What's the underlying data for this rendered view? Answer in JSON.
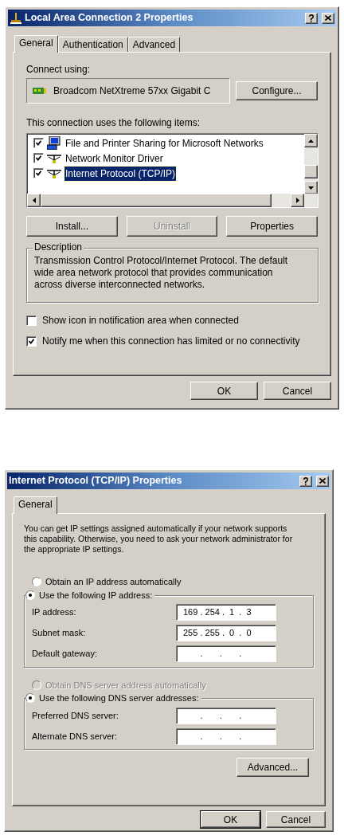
{
  "connection_dialog": {
    "title": "Local Area Connection 2 Properties",
    "tabs": [
      {
        "label": "General",
        "selected": true
      },
      {
        "label": "Authentication",
        "selected": false
      },
      {
        "label": "Advanced",
        "selected": false
      }
    ],
    "connect_using_label": "Connect using:",
    "adapter": "Broadcom NetXtreme 57xx Gigabit C",
    "configure_button": "Configure...",
    "items_label": "This connection uses the following items:",
    "items": [
      {
        "label": "File and Printer Sharing for Microsoft Networks",
        "kind": "service",
        "checked": true,
        "selected": false
      },
      {
        "label": "Network Monitor Driver",
        "kind": "protocol",
        "checked": true,
        "selected": false
      },
      {
        "label": "Internet Protocol (TCP/IP)",
        "kind": "protocol",
        "checked": true,
        "selected": true
      }
    ],
    "item_buttons": [
      {
        "label": "Install...",
        "disabled": false
      },
      {
        "label": "Uninstall",
        "disabled": true
      },
      {
        "label": "Properties",
        "disabled": false
      }
    ],
    "description": {
      "legend": "Description",
      "text": "Transmission Control Protocol/Internet Protocol. The default wide area network protocol that provides communication across diverse interconnected networks."
    },
    "options": [
      {
        "label": "Show icon in notification area when connected",
        "checked": false
      },
      {
        "label": "Notify me when this connection has limited or no connectivity",
        "checked": true
      }
    ],
    "footer_buttons": [
      {
        "label": "OK",
        "default": false
      },
      {
        "label": "Cancel",
        "default": false
      }
    ]
  },
  "tcpip_dialog": {
    "title": "Internet Protocol (TCP/IP) Properties",
    "tabs": [
      {
        "label": "General",
        "selected": true
      }
    ],
    "intro": "You can get IP settings assigned automatically if your network supports this capability. Otherwise, you need to ask your network administrator for the appropriate IP settings.",
    "ip_modes": [
      {
        "label": "Obtain an IP address automatically",
        "selected": false,
        "disabled": false
      },
      {
        "label": "Use the following IP address:",
        "selected": true,
        "disabled": false
      }
    ],
    "ip_fields": [
      {
        "label": "IP address:",
        "value": "169 . 254 .  1  .  3"
      },
      {
        "label": "Subnet mask:",
        "value": "255 . 255 .  0  .  0"
      },
      {
        "label": "Default gateway:",
        "value": "       .       .       ."
      }
    ],
    "dns_modes": [
      {
        "label": "Obtain DNS server address automatically",
        "selected": false,
        "disabled": true
      },
      {
        "label": "Use the following DNS server addresses:",
        "selected": true,
        "disabled": false
      }
    ],
    "dns_fields": [
      {
        "label": "Preferred DNS server:",
        "value": "       .       .       ."
      },
      {
        "label": "Alternate DNS server:",
        "value": "       .       .       ."
      }
    ],
    "advanced_button": "Advanced...",
    "footer_buttons": [
      {
        "label": "OK",
        "default": true
      },
      {
        "label": "Cancel",
        "default": false
      }
    ]
  }
}
